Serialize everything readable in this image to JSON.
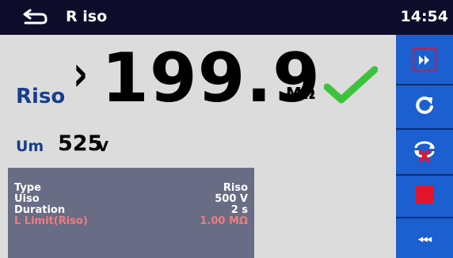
{
  "titlebar": {
    "title": "R iso",
    "time": "14:54"
  },
  "result": {
    "riso_label": "Riso",
    "riso_prefix": "›",
    "riso_value": "199.9",
    "riso_unit": "MΩ",
    "um_label": "Um",
    "um_value": "525",
    "um_unit": "V"
  },
  "params": [
    {
      "label": "Type",
      "value": "Riso",
      "highlight": false
    },
    {
      "label": "Uiso",
      "value": "500 V",
      "highlight": false
    },
    {
      "label": "Duration",
      "value": "2 s",
      "highlight": false
    },
    {
      "label": "L Limit(Riso)",
      "value": "1.00 MΩ",
      "highlight": true
    }
  ],
  "sidebar": {
    "buttons": [
      {
        "name": "fast-forward",
        "icon": "fast-forward-icon"
      },
      {
        "name": "repeat",
        "icon": "redo-icon"
      },
      {
        "name": "cancel-loop",
        "icon": "loop-cancel-icon"
      },
      {
        "name": "stop",
        "icon": "stop-icon"
      },
      {
        "name": "more",
        "label": "◂◂◂"
      }
    ]
  },
  "colors": {
    "titlebar": "#0d0d2b",
    "accent_blue": "#183e8c",
    "sidebar": "#1b5fd0",
    "check_green": "#3cc33c",
    "stop_red": "#e3142a",
    "limit_text": "#f27c7c",
    "params_bg": "#686c84"
  }
}
